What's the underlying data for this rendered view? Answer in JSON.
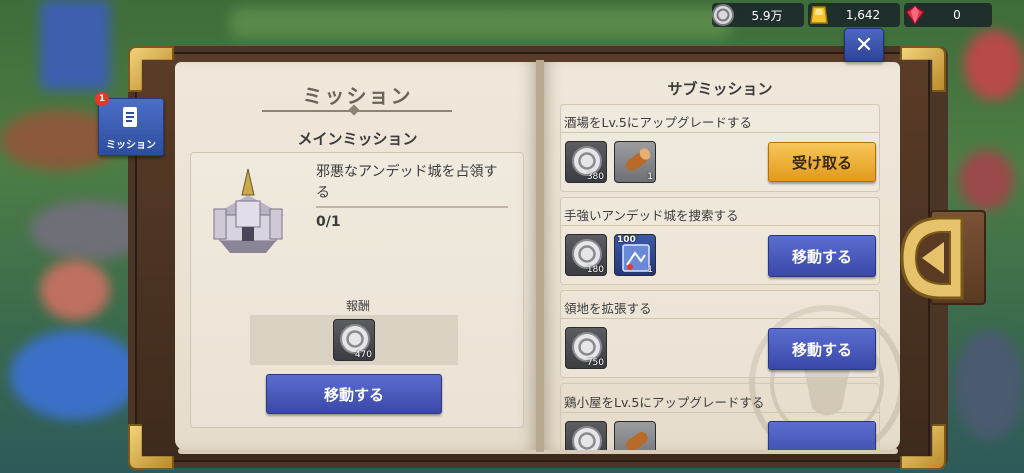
{
  "resources": {
    "silver": "5.9万",
    "gold": "1,642",
    "gems": "0"
  },
  "bookmark": {
    "label": "ミッション",
    "badge": "1"
  },
  "left_page": {
    "title": "ミッション",
    "main_heading": "メインミッション",
    "mission_text": "邪悪なアンデッド城を占領する",
    "progress": "0/1",
    "reward_label": "報酬",
    "reward_count": "470",
    "go_button": "移動する"
  },
  "right_page": {
    "title": "サブミッション",
    "missions": [
      {
        "label": "酒場をLv.5にアップグレードする",
        "reward1_count": "380",
        "reward2_count": "1",
        "button": "受け取る"
      },
      {
        "label": "手強いアンデッド城を捜索する",
        "reward1_count": "180",
        "reward2_count": "1",
        "reward2_badge": "100",
        "button": "移動する"
      },
      {
        "label": "領地を拡張する",
        "reward1_count": "750",
        "button": "移動する"
      },
      {
        "label": "鶏小屋をLv.5にアップグレードする"
      }
    ]
  },
  "close_icon": "close-icon",
  "colors": {
    "blue_button": "#3a48a8",
    "gold_button": "#e29a1a",
    "page": "#efe8db"
  }
}
